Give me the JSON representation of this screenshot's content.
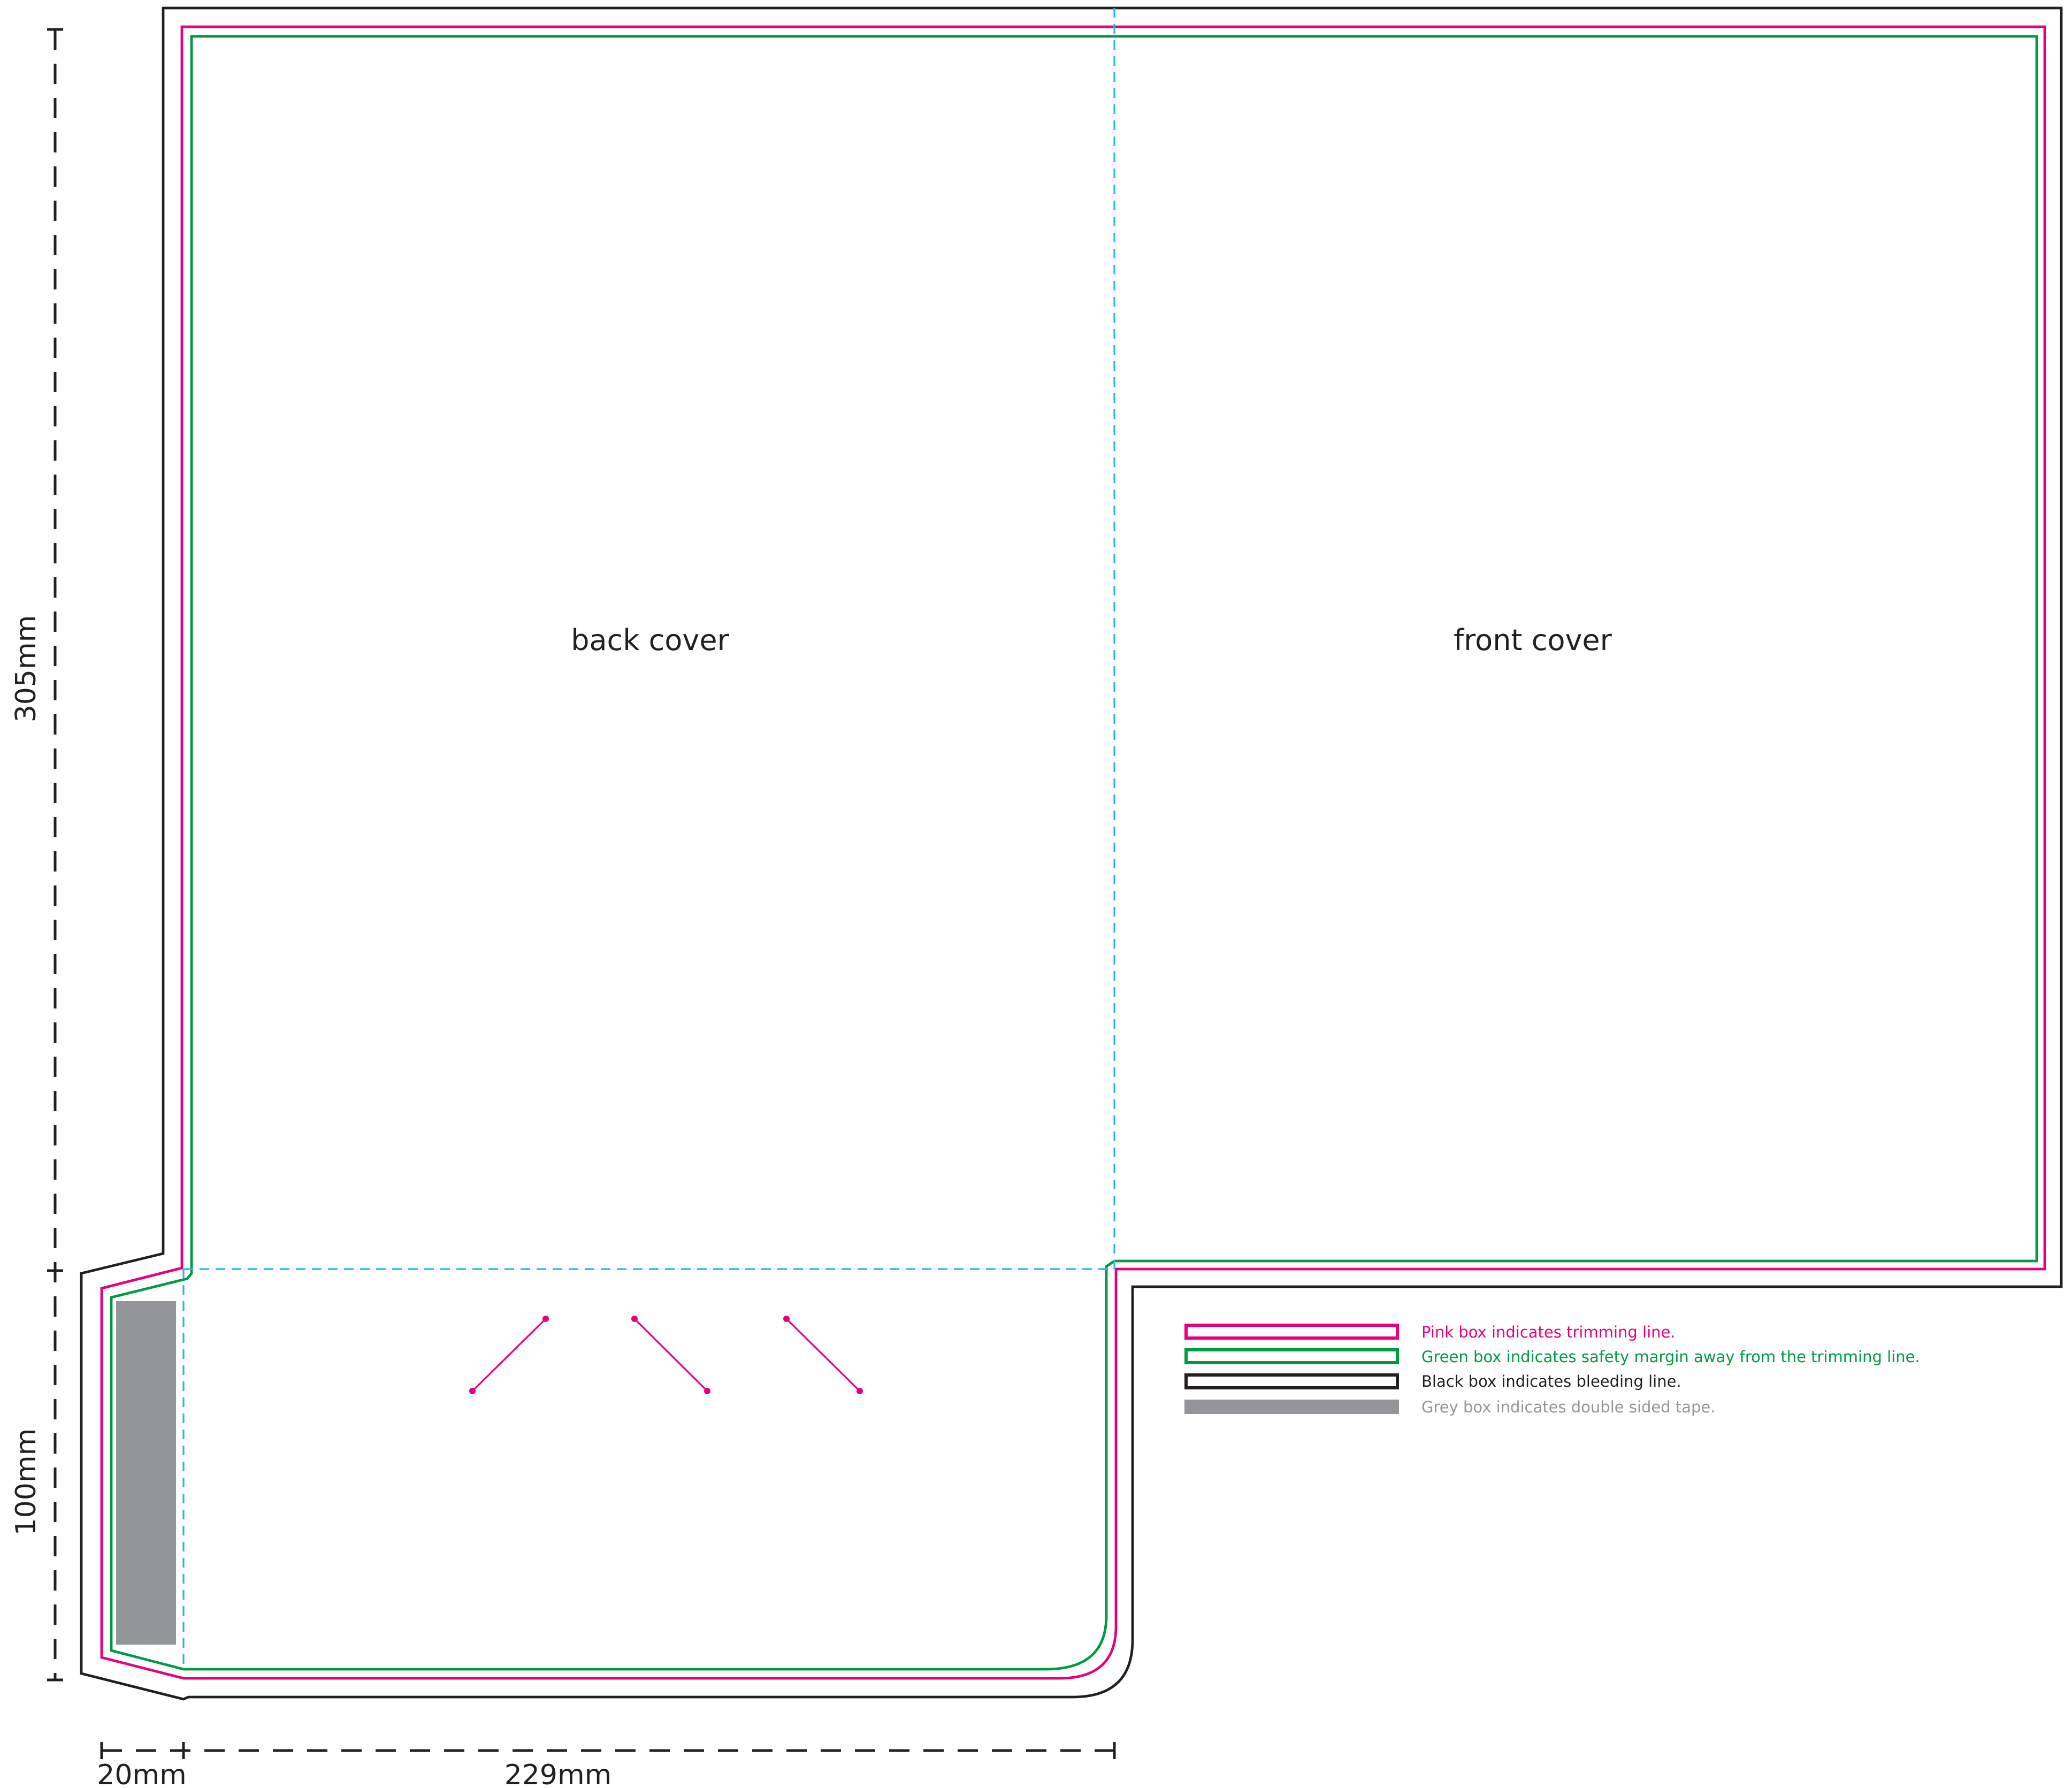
{
  "covers": {
    "back": "back cover",
    "front": "front cover"
  },
  "dimensions": {
    "height_main": "305mm",
    "height_pocket": "100mm",
    "width_flap": "20mm",
    "width_panel": "229mm"
  },
  "legend": [
    {
      "swatch": "pink-outline",
      "text": "Pink box indicates trimming line.",
      "color": "#e6007e"
    },
    {
      "swatch": "green-outline",
      "text": "Green box indicates safety margin away from the trimming line.",
      "color": "#009a44"
    },
    {
      "swatch": "black-outline",
      "text": "Black box indicates bleeding line.",
      "color": "#231f20"
    },
    {
      "swatch": "grey-fill",
      "text": "Grey box indicates double sided tape.",
      "color": "#939598"
    }
  ],
  "colors": {
    "trim": "#e6007e",
    "safety": "#009a44",
    "bleed": "#231f20",
    "fold": "#29b8d8",
    "tape": "#939598"
  }
}
